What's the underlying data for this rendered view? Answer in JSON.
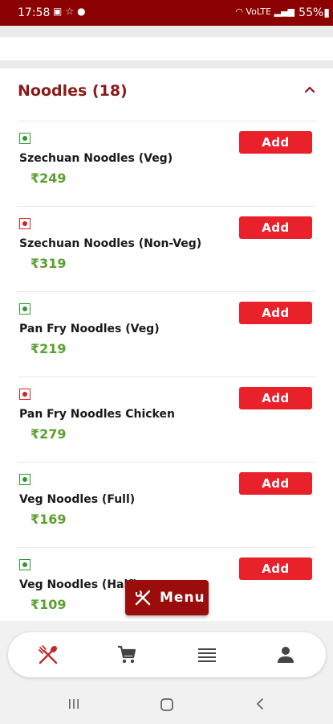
{
  "status_bar": {
    "time": "17:58",
    "left_icons": [
      "image-icon",
      "star-icon",
      "location-icon"
    ],
    "right_text": "VoLTE",
    "battery": "55%"
  },
  "section": {
    "title": "Noodles (18)",
    "expanded": true
  },
  "colors": {
    "brand": "#8b0000",
    "add_button": "#e8212a",
    "price": "#5aa02c",
    "veg": "#2e9a2e",
    "nonveg": "#d62020"
  },
  "items": [
    {
      "name": "Szechuan Noodles (Veg)",
      "price": "₹249",
      "type": "veg",
      "button": "Add"
    },
    {
      "name": "Szechuan Noodles (Non-Veg)",
      "price": "₹319",
      "type": "nonveg",
      "button": "Add"
    },
    {
      "name": "Pan Fry Noodles (Veg)",
      "price": "₹219",
      "type": "veg",
      "button": "Add"
    },
    {
      "name": "Pan Fry Noodles Chicken",
      "price": "₹279",
      "type": "nonveg",
      "button": "Add"
    },
    {
      "name": "Veg Noodles (Full)",
      "price": "₹169",
      "type": "veg",
      "button": "Add"
    },
    {
      "name": "Veg Noodles (Half)",
      "price": "₹109",
      "type": "veg",
      "button": "Add"
    }
  ],
  "menu_fab": {
    "label": "Menu",
    "icon": "fork-knife-icon"
  },
  "bottom_nav": {
    "items": [
      {
        "icon": "fork-spoon-icon",
        "active": true
      },
      {
        "icon": "cart-icon",
        "active": false
      },
      {
        "icon": "list-icon",
        "active": false
      },
      {
        "icon": "profile-icon",
        "active": false
      }
    ]
  },
  "system_nav": [
    "recents-icon",
    "home-icon",
    "back-icon"
  ]
}
